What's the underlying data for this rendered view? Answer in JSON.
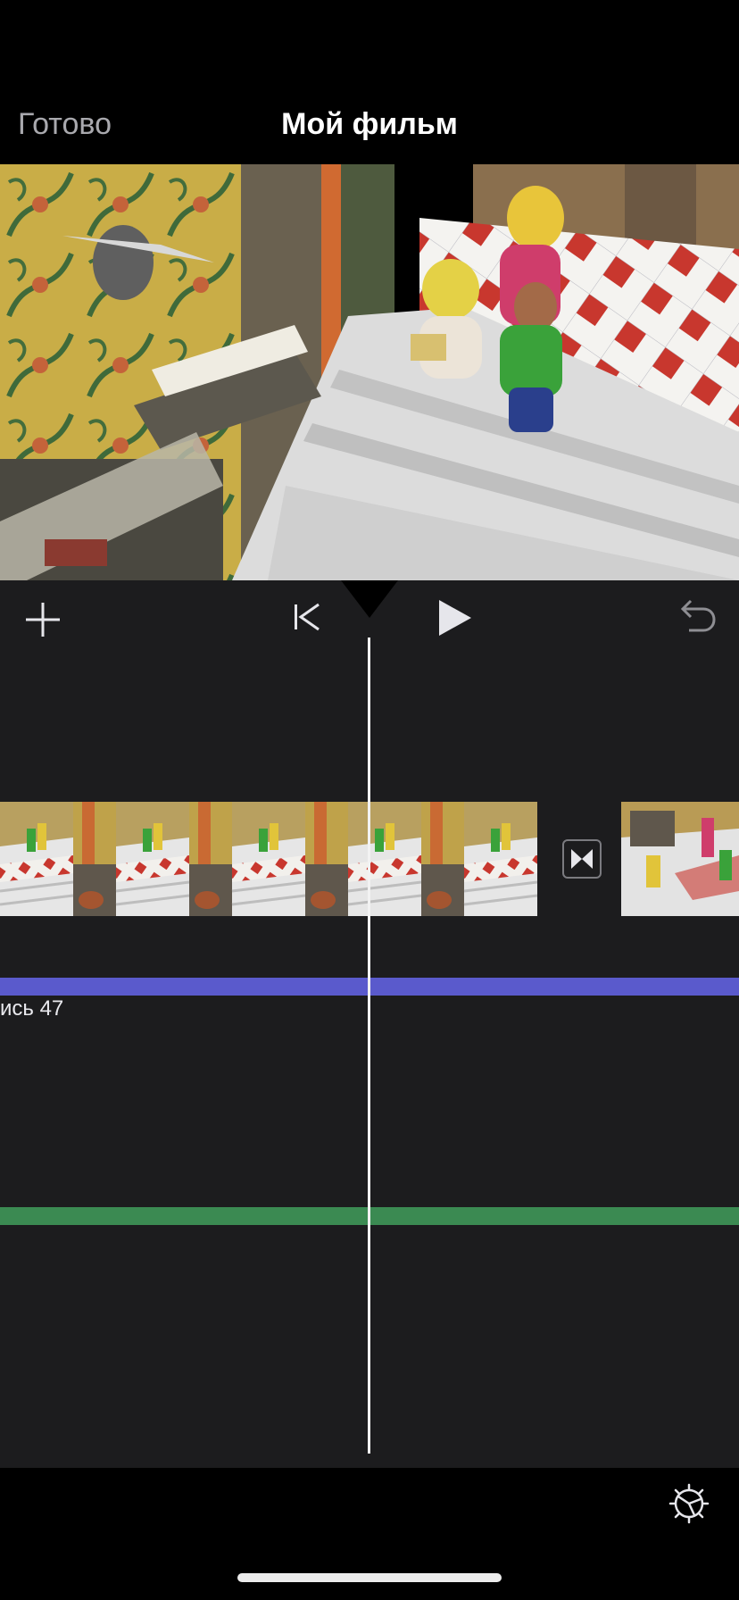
{
  "nav": {
    "done_label": "Готово",
    "title": "Мой фильм"
  },
  "toolbar": {
    "add_icon": "plus-icon",
    "rewind_icon": "skip-to-start-icon",
    "play_icon": "play-icon",
    "undo_icon": "undo-icon"
  },
  "timeline": {
    "transition_icon": "bowtie-transition-icon",
    "audio_track_label": "ись 47",
    "audio_track_color": "#5a5acc",
    "music_track_color": "#3b8a52",
    "playhead_color": "#f2f2f2"
  },
  "bottom": {
    "settings_icon": "gear-icon"
  }
}
